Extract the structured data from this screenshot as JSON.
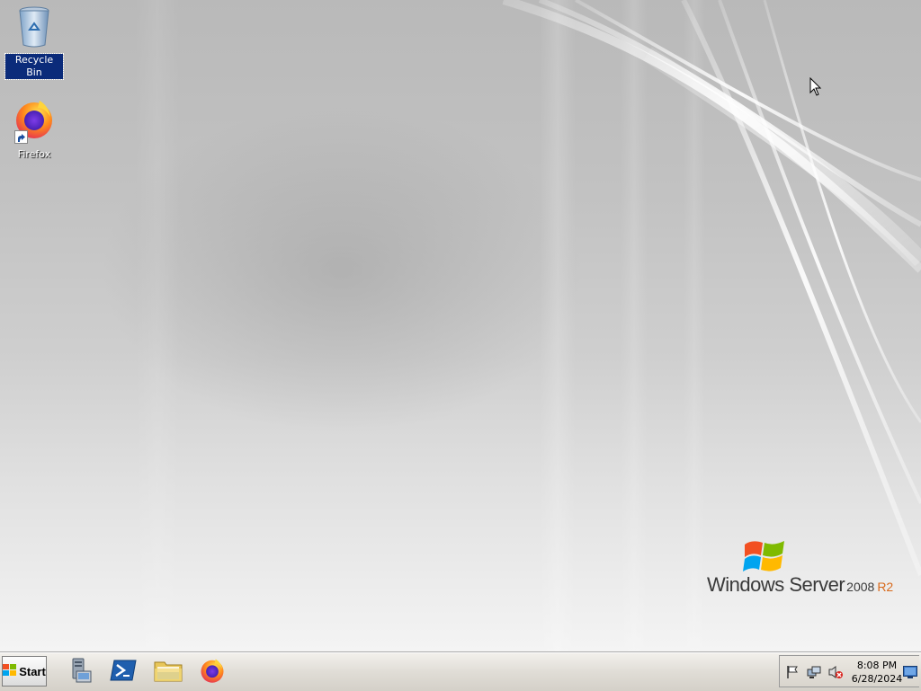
{
  "desktop": {
    "icons": [
      {
        "label": "Recycle Bin",
        "icon": "recycle-bin-icon",
        "selected": true
      },
      {
        "label": "Firefox",
        "icon": "firefox-icon",
        "shortcut": true
      }
    ],
    "branding": {
      "wordmark": "Windows Server",
      "year": "2008",
      "release": "R2"
    }
  },
  "taskbar": {
    "start_label": "Start",
    "quick_launch": [
      {
        "name": "Server Manager",
        "icon": "server-manager-icon"
      },
      {
        "name": "Windows PowerShell",
        "icon": "powershell-icon"
      },
      {
        "name": "Windows Explorer",
        "icon": "folder-icon"
      },
      {
        "name": "Firefox",
        "icon": "firefox-icon"
      }
    ],
    "tray": {
      "icons": [
        "action-center-flag-icon",
        "network-icon",
        "volume-muted-icon",
        "show-desktop-icon"
      ],
      "time": "8:08 PM",
      "date": "6/28/2024"
    }
  },
  "colors": {
    "selection": "#0b2b7a",
    "r2_accent": "#d86a1c"
  }
}
